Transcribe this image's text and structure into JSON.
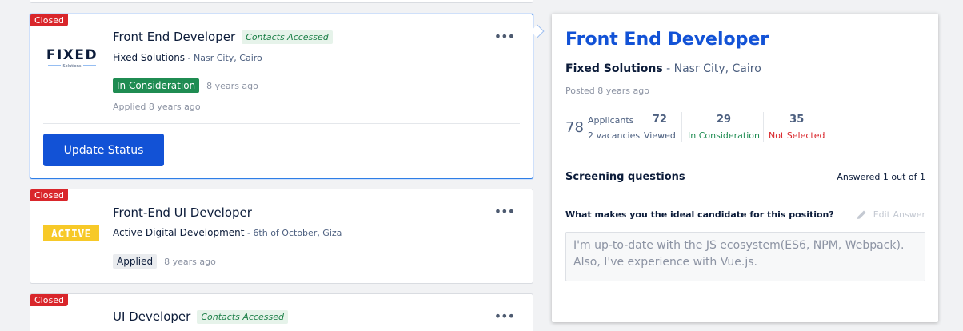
{
  "jobs": [
    {
      "closed_label": "Closed",
      "logo_text": "FIXED",
      "logo_sub": "Solutions",
      "title": "Front End Developer",
      "badge": "Contacts Accessed",
      "company": "Fixed Solutions",
      "location": " - Nasr City, Cairo",
      "status": "In Consideration",
      "status_ago": "8 years ago",
      "applied": "Applied 8 years ago",
      "menu_icon": "•••",
      "button": "Update Status"
    },
    {
      "closed_label": "Closed",
      "logo_text": "ACTIVE",
      "title": "Front-End UI Developer",
      "company": "Active Digital Development",
      "location": " - 6th of October, Giza",
      "status": "Applied",
      "status_ago": "8 years ago",
      "menu_icon": "•••"
    },
    {
      "closed_label": "Closed",
      "title": "UI Developer",
      "badge": "Contacts Accessed",
      "menu_icon": "•••"
    }
  ],
  "detail": {
    "title": "Front End Developer",
    "company": "Fixed Solutions",
    "location": " - Nasr City, Cairo",
    "posted": "Posted 8 years ago",
    "applicants_count": "78",
    "applicants_label": "Applicants",
    "vacancies": "2 vacancies",
    "viewed_count": "72",
    "viewed_label": "Viewed",
    "consideration_count": "29",
    "consideration_label": "In Consideration",
    "not_selected_count": "35",
    "not_selected_label": "Not Selected",
    "screening_title": "Screening questions",
    "answered": "Answered 1 out of 1",
    "question": "What makes you the ideal candidate for this position?",
    "edit_answer": "Edit Answer",
    "answer": "I'm up-to-date with the JS ecosystem(ES6, NPM, Webpack). Also, I've experience with Vue.js."
  },
  "colors": {
    "accent": "#1252d6",
    "closed": "#d9262b",
    "consideration": "#1f8c52",
    "not_selected": "#d9262b"
  }
}
